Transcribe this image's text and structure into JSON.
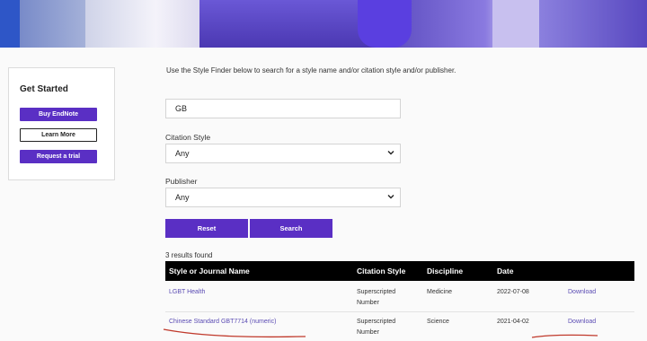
{
  "sidebar": {
    "title": "Get Started",
    "buttons": [
      "Buy EndNote",
      "Learn More",
      "Request a trial"
    ]
  },
  "intro": "Use the Style Finder below to search for a style name and/or citation style and/or publisher.",
  "search": {
    "value": "GB"
  },
  "citation_style": {
    "label": "Citation Style",
    "value": "Any"
  },
  "publisher": {
    "label": "Publisher",
    "value": "Any"
  },
  "actions": {
    "reset": "Reset",
    "search": "Search"
  },
  "results": {
    "count_text": "3 results found",
    "headers": [
      "Style or Journal Name",
      "Citation Style",
      "Discipline",
      "Date"
    ],
    "rows": [
      {
        "name": "LGBT Health",
        "style_line1": "Superscripted",
        "style_line2": "Number",
        "discipline": "Medicine",
        "date": "2022-07-08",
        "action": "Download"
      },
      {
        "name": "Chinese Standard GBT7714 (numeric)",
        "style_line1": "Superscripted",
        "style_line2": "Number",
        "discipline": "Science",
        "date": "2021-04-02",
        "action": "Download"
      }
    ]
  },
  "icons": [
    "chevron-down-icon"
  ],
  "colors": {
    "accent": "#5a2fc4",
    "header_bg": "#000000",
    "link": "#5a4bb3"
  }
}
